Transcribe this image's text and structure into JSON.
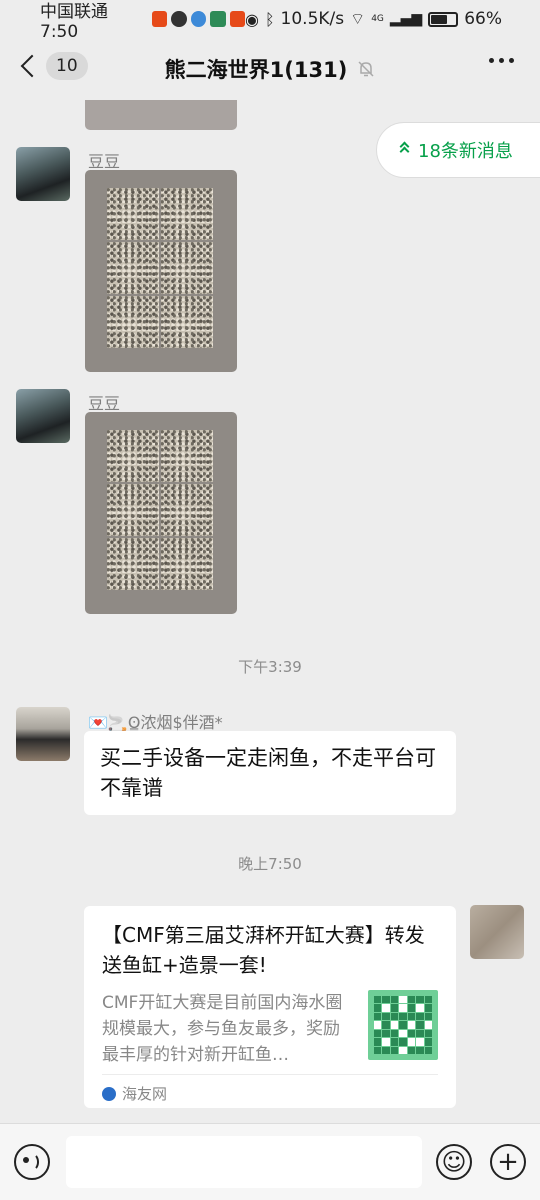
{
  "status_bar": {
    "carrier_time": "中国联通 7:50",
    "network_speed": "10.5K/s",
    "network_type": "4G",
    "battery_pct": "66%",
    "battery_level": 0.66
  },
  "header": {
    "unread_count": "10",
    "title": "熊二海世界1(131)"
  },
  "new_messages_pill": "18条新消息",
  "messages": {
    "m1": {
      "sender": "豆豆"
    },
    "m2": {
      "sender": "豆豆"
    },
    "time1": "下午3:39",
    "m3": {
      "sender": "💌🚬ʘ̳浓烟$伴酒*",
      "text": "买二手设备一定走闲鱼，不走平台可不靠谱"
    },
    "time2": "晚上7:50",
    "m4": {
      "title": "【CMF第三届艾湃杯开缸大赛】转发送鱼缸+造景一套!",
      "desc": "CMF开缸大赛是目前国内海水圈规模最大，参与鱼友最多，奖励最丰厚的针对新开缸鱼…",
      "source": "海友网"
    }
  },
  "colors": {
    "background": "#ededed",
    "accent_green": "#07a04a",
    "bubble_white": "#ffffff"
  }
}
